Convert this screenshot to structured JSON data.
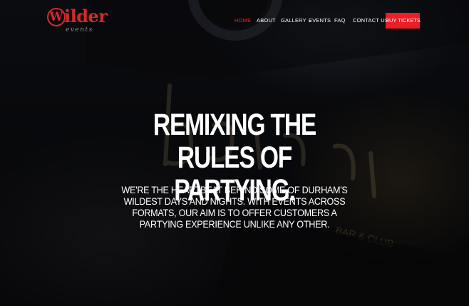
{
  "brand": {
    "logo_initial": "W",
    "logo_rest": "ilder",
    "logo_tagline": "events"
  },
  "nav": {
    "items": [
      {
        "label": "HOME",
        "active": true
      },
      {
        "label": "ABOUT"
      },
      {
        "label": "GALLERY",
        "has_dropdown": true
      },
      {
        "label": "EVENTS"
      },
      {
        "label": "FAQ"
      },
      {
        "label": "CONTACT US"
      }
    ],
    "cta_label": "BUY TICKETS"
  },
  "hero": {
    "title": "REMIXING THE RULES OF PARTYING.",
    "subtitle": "WE'RE THE HEARTBEAT BEHIND SOME OF DURHAM'S WILDEST DAYS AND NIGHTS. WITH EVENTS ACROSS FORMATS, OUR AIM IS TO OFFER CUSTOMERS A PARTYING EXPERIENCE UNLIKE ANY OTHER."
  },
  "colors": {
    "accent": "#ec1d24",
    "active_nav": "#e5262a",
    "logo": "#d42a2a",
    "text": "#ffffff"
  }
}
